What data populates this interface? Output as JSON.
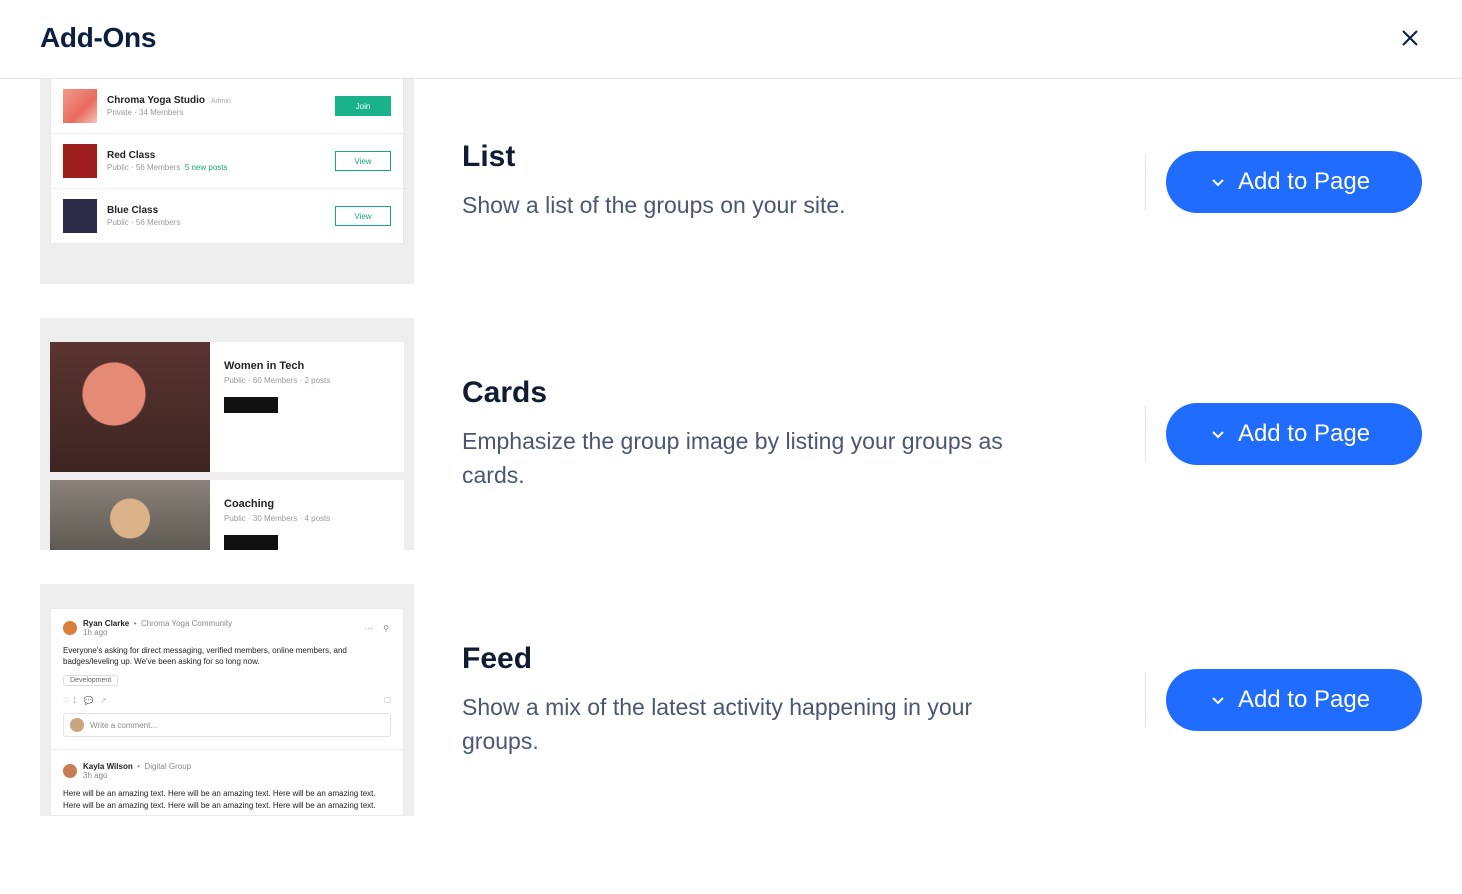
{
  "header": {
    "title": "Add-Ons"
  },
  "items": [
    {
      "title": "List",
      "description": "Show a list of the groups on your site.",
      "button": "Add to Page",
      "preview": {
        "rows": [
          {
            "title": "Chroma Yoga Studio",
            "admin": "Admin",
            "sub": "Private · 34 Members",
            "extra": "",
            "btn": "Join",
            "solid": true
          },
          {
            "title": "Red Class",
            "admin": "",
            "sub": "Public · 56 Members",
            "extra": "5 new posts",
            "btn": "View",
            "solid": false
          },
          {
            "title": "Blue Class",
            "admin": "",
            "sub": "Public · 56 Members",
            "extra": "",
            "btn": "View",
            "solid": false
          }
        ]
      }
    },
    {
      "title": "Cards",
      "description": "Emphasize the group image by listing your groups as cards.",
      "button": "Add to Page",
      "preview": {
        "cards": [
          {
            "title": "Women in Tech",
            "sub": "Public · 60 Members · 2 posts"
          },
          {
            "title": "Coaching",
            "sub": "Public · 30 Members · 4 posts"
          }
        ]
      }
    },
    {
      "title": "Feed",
      "description": "Show a mix of the latest activity happening in your groups.",
      "button": "Add to Page",
      "preview": {
        "post_author": "Ryan Clarke",
        "post_group": "Chroma Yoga Community",
        "post_time": "1h ago",
        "post_body": "Everyone's asking for direct messaging, verified members, online members, and badges/leveling up. We've been asking for so long now.",
        "post_chip": "Development",
        "comment_placeholder": "Write a comment...",
        "post2_author": "Kayla Wilson",
        "post2_group": "Digital Group",
        "post2_time": "3h ago",
        "post2_body": "Here will be an amazing text. Here will be an amazing text. Here will be an amazing text. Here will be an amazing text. Here will be an amazing text. Here will be an amazing text."
      }
    }
  ]
}
